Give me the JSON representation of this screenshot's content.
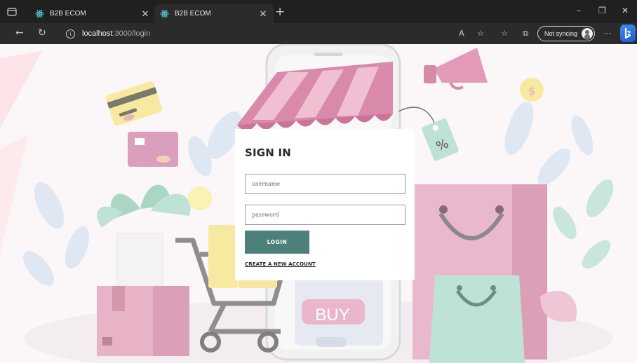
{
  "browser": {
    "tabs": [
      {
        "title": "B2B ECOM"
      },
      {
        "title": "B2B ECOM"
      }
    ],
    "url_host": "localhost",
    "url_path": ":3000/login",
    "sync_label": "Not syncing",
    "window_controls": {
      "minimize": "–",
      "restore": "❐",
      "close": "✕"
    },
    "new_tab": "+"
  },
  "hero": {
    "buy_label": "BUY",
    "percent_tag": "%",
    "coin_symbol": "$"
  },
  "login": {
    "title": "SIGN IN",
    "username_placeholder": "username",
    "password_placeholder": "password",
    "button_label": "LOGIN",
    "create_account_link": "CREATE A NEW ACCOUNT"
  },
  "colors": {
    "accent": "#4d7f7b",
    "page_bg": "#fbf6f7",
    "illustration_pink": "#e3a8c2",
    "illustration_mint": "#bfe2d6",
    "illustration_yellow": "#f7eaa0"
  }
}
